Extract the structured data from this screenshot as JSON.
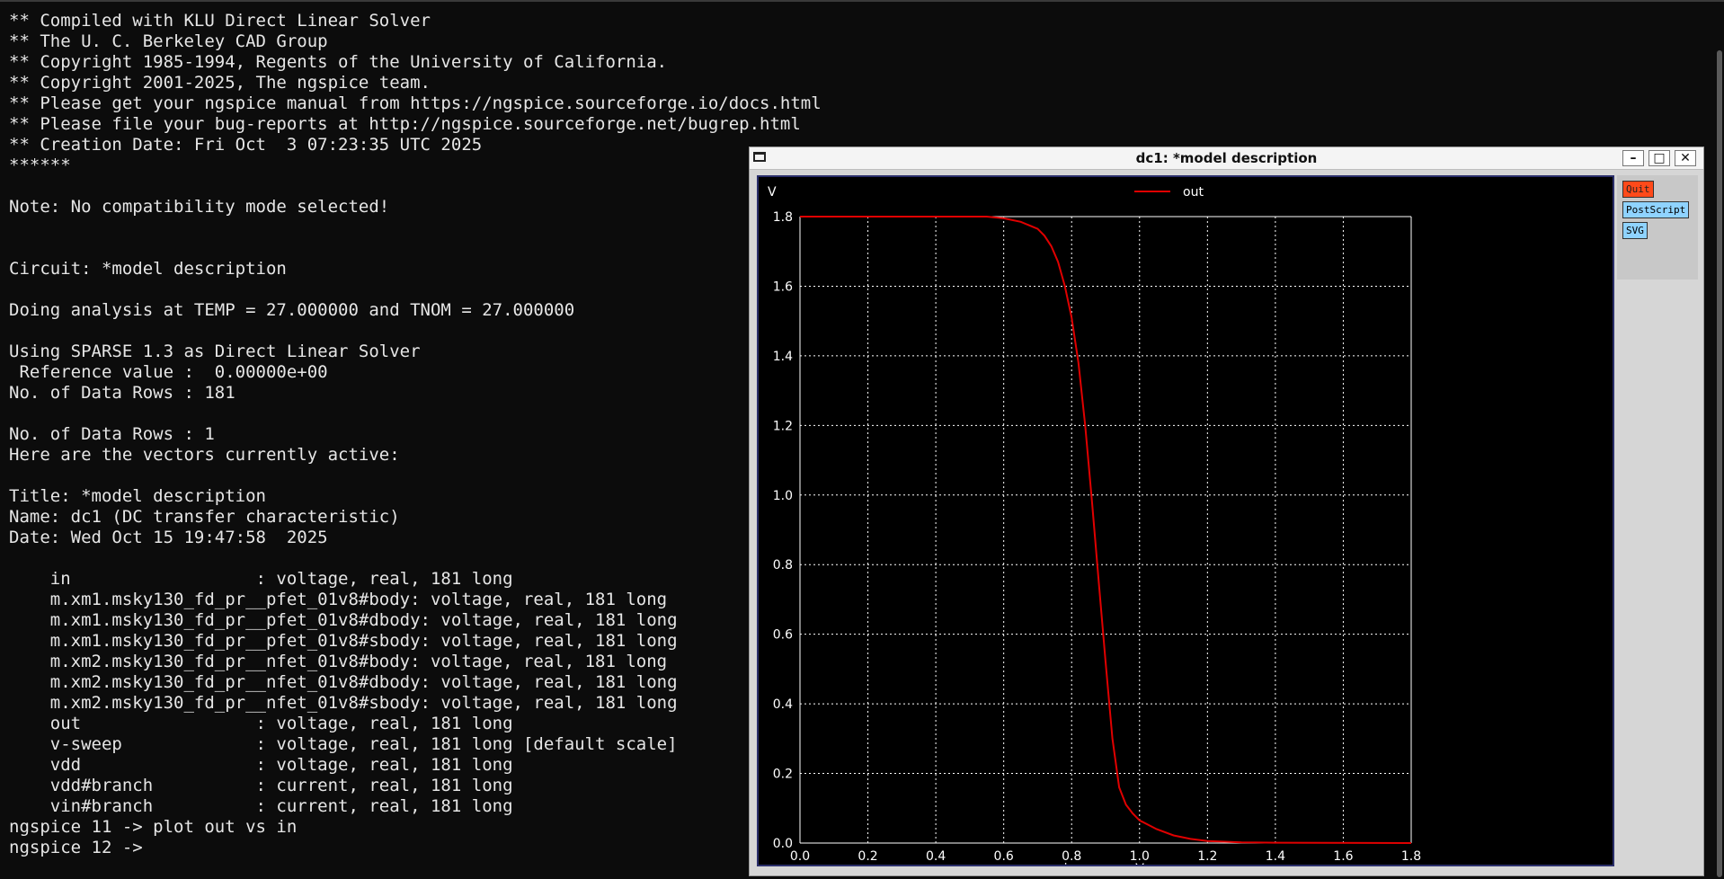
{
  "terminal": {
    "lines": [
      "** Compiled with KLU Direct Linear Solver",
      "** The U. C. Berkeley CAD Group",
      "** Copyright 1985-1994, Regents of the University of California.",
      "** Copyright 2001-2025, The ngspice team.",
      "** Please get your ngspice manual from https://ngspice.sourceforge.io/docs.html",
      "** Please file your bug-reports at http://ngspice.sourceforge.net/bugrep.html",
      "** Creation Date: Fri Oct  3 07:23:35 UTC 2025",
      "******",
      "",
      "Note: No compatibility mode selected!",
      "",
      "",
      "Circuit: *model description",
      "",
      "Doing analysis at TEMP = 27.000000 and TNOM = 27.000000",
      "",
      "Using SPARSE 1.3 as Direct Linear Solver",
      " Reference value :  0.00000e+00",
      "No. of Data Rows : 181",
      "",
      "No. of Data Rows : 1",
      "Here are the vectors currently active:",
      "",
      "Title: *model description",
      "Name: dc1 (DC transfer characteristic)",
      "Date: Wed Oct 15 19:47:58  2025",
      "",
      "    in                  : voltage, real, 181 long",
      "    m.xm1.msky130_fd_pr__pfet_01v8#body: voltage, real, 181 long",
      "    m.xm1.msky130_fd_pr__pfet_01v8#dbody: voltage, real, 181 long",
      "    m.xm1.msky130_fd_pr__pfet_01v8#sbody: voltage, real, 181 long",
      "    m.xm2.msky130_fd_pr__nfet_01v8#body: voltage, real, 181 long",
      "    m.xm2.msky130_fd_pr__nfet_01v8#dbody: voltage, real, 181 long",
      "    m.xm2.msky130_fd_pr__nfet_01v8#sbody: voltage, real, 181 long",
      "    out                 : voltage, real, 181 long",
      "    v-sweep             : voltage, real, 181 long [default scale]",
      "    vdd                 : voltage, real, 181 long",
      "    vdd#branch          : current, real, 181 long",
      "    vin#branch          : current, real, 181 long",
      "ngspice 11 -> plot out vs in",
      "ngspice 12 -> "
    ]
  },
  "plot_window": {
    "title": "dc1: *model description",
    "buttons": {
      "minimize": "–",
      "maximize": "□",
      "close": "✕"
    },
    "side_buttons": {
      "quit": "Quit",
      "postscript": "PostScript",
      "svg": "SVG"
    }
  },
  "colors": {
    "terminal_bg": "#0c0c0c",
    "plot_bg": "#000000",
    "grid": "#ffffff",
    "trace": "#e00000",
    "quit_button": "#ff4a1a",
    "action_button": "#8fd3ff"
  },
  "chart_data": {
    "type": "line",
    "title": "",
    "xlabel": "in",
    "xunit": "V",
    "ylabel": "",
    "yunit": "V",
    "xlim": [
      0,
      1.8
    ],
    "ylim": [
      0,
      1.8
    ],
    "xticks": [
      "0.0",
      "0.2",
      "0.4",
      "0.6",
      "0.8",
      "1.0",
      "1.2",
      "1.4",
      "1.6",
      "1.8"
    ],
    "yticks": [
      "0.0",
      "0.2",
      "0.4",
      "0.6",
      "0.8",
      "1.0",
      "1.2",
      "1.4",
      "1.6",
      "1.8"
    ],
    "grid": true,
    "legend": "top-center",
    "series": [
      {
        "name": "out",
        "x": [
          0.0,
          0.55,
          0.6,
          0.65,
          0.7,
          0.72,
          0.74,
          0.76,
          0.78,
          0.8,
          0.82,
          0.84,
          0.86,
          0.88,
          0.9,
          0.92,
          0.94,
          0.96,
          0.98,
          1.0,
          1.05,
          1.1,
          1.15,
          1.2,
          1.3,
          1.4,
          1.8
        ],
        "y": [
          1.8,
          1.8,
          1.795,
          1.785,
          1.765,
          1.745,
          1.715,
          1.67,
          1.6,
          1.51,
          1.38,
          1.2,
          0.98,
          0.75,
          0.52,
          0.3,
          0.16,
          0.11,
          0.085,
          0.065,
          0.04,
          0.022,
          0.012,
          0.006,
          0.002,
          0.001,
          0.0
        ]
      }
    ]
  }
}
